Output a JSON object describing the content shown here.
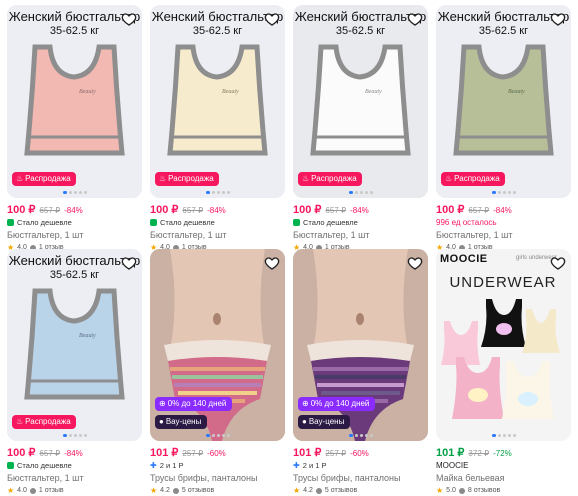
{
  "cards": [
    {
      "overlay_title": "Женский бюстгальтер",
      "overlay_weight": "35-62.5 кг",
      "badge": "Распродажа",
      "price": "100 ₽",
      "old_price": "657 ₽",
      "discount": "-84%",
      "promo": "Стало дешевле",
      "title": "Бюстгальтер, 1 шт",
      "rating": "4.0",
      "reviews": "1 отзыв",
      "bra_color": "#f2b8b2",
      "trim_color": "#8e8e8e",
      "bg": "#eceef3"
    },
    {
      "overlay_title": "Женский бюстгальтер",
      "overlay_weight": "35-62.5 кг",
      "badge": "Распродажа",
      "price": "100 ₽",
      "old_price": "657 ₽",
      "discount": "-84%",
      "promo": "Стало дешевле",
      "title": "Бюстгальтер, 1 шт",
      "rating": "4.0",
      "reviews": "1 отзыв",
      "bra_color": "#f6ebcd",
      "trim_color": "#8e8e8e",
      "bg": "#eceef3"
    },
    {
      "overlay_title": "Женский бюстгальтер",
      "overlay_weight": "35-62.5 кг",
      "badge": "Распродажа",
      "price": "100 ₽",
      "old_price": "657 ₽",
      "discount": "-84%",
      "promo": "Стало дешевле",
      "title": "Бюстгальтер, 1 шт",
      "rating": "4.0",
      "reviews": "1 отзыв",
      "bra_color": "#fbfbfb",
      "trim_color": "#8e8e8e",
      "bg": "#e8eaee"
    },
    {
      "overlay_title": "Женский бюстгальтер",
      "overlay_weight": "35-62.5 кг",
      "badge": "Распродажа",
      "price": "100 ₽",
      "old_price": "657 ₽",
      "discount": "-84%",
      "promo": "996 ед осталось",
      "title": "Бюстгальтер, 1 шт",
      "rating": "4.0",
      "reviews": "1 отзыв",
      "bra_color": "#b6bf98",
      "trim_color": "#8e8e8e",
      "bg": "#eceef3"
    },
    {
      "overlay_title": "Женский бюстгальтер",
      "overlay_weight": "35-62.5 кг",
      "badge": "Распродажа",
      "price": "100 ₽",
      "old_price": "657 ₽",
      "discount": "-84%",
      "promo": "Стало дешевле",
      "title": "Бюстгальтер, 1 шт",
      "rating": "4.0",
      "reviews": "1 отзыв",
      "bra_color": "#b9d3e8",
      "trim_color": "#8e8e8e",
      "bg": "#eceef3"
    },
    {
      "badge_installment": "0% до 140 дней",
      "badge_vau": "Вау-цены",
      "price": "101 ₽",
      "old_price": "257 ₽",
      "discount": "-60%",
      "promo": "2 и 1 Р",
      "title": "Трусы брифы, панталоны",
      "rating": "4.2",
      "reviews": "5 отзывов",
      "stripe_colors": [
        "#d26a8a",
        "#e6a47c",
        "#9ac29c",
        "#b87fb6",
        "#f1d08a"
      ],
      "bg": "#d9c2b4"
    },
    {
      "badge_installment": "0% до 140 дней",
      "badge_vau": "Вау-цены",
      "price": "101 ₽",
      "old_price": "257 ₽",
      "discount": "-60%",
      "promo": "2 и 1 Р",
      "title": "Трусы брифы, панталоны",
      "rating": "4.2",
      "reviews": "5 отзывов",
      "stripe_colors": [
        "#6b3a7a",
        "#9a6aa6",
        "#4a3a6a",
        "#c79ad0",
        "#6e5a8a"
      ],
      "bg": "#d9c2b4"
    },
    {
      "brand_logo": "MOOCIE",
      "image_label": "girls underwear",
      "image_banner": "UNDERWEAR",
      "price": "101 ₽",
      "old_price": "372 ₽",
      "discount": "-72%",
      "brand": "MOOCIE",
      "title": "Майка бельевая",
      "rating": "5.0",
      "reviews": "8 отзывов",
      "bg": "#f4f4f4"
    }
  ],
  "icons": {
    "heart": "heart-icon",
    "fire": "fire-icon",
    "star": "star-icon",
    "review": "review-bubble-icon",
    "promo": "promo-tag-icon"
  },
  "colors": {
    "sale": "#f6175e",
    "green_price": "#00a046",
    "installment": "#8a2cff",
    "vau": "#2a1a44"
  }
}
